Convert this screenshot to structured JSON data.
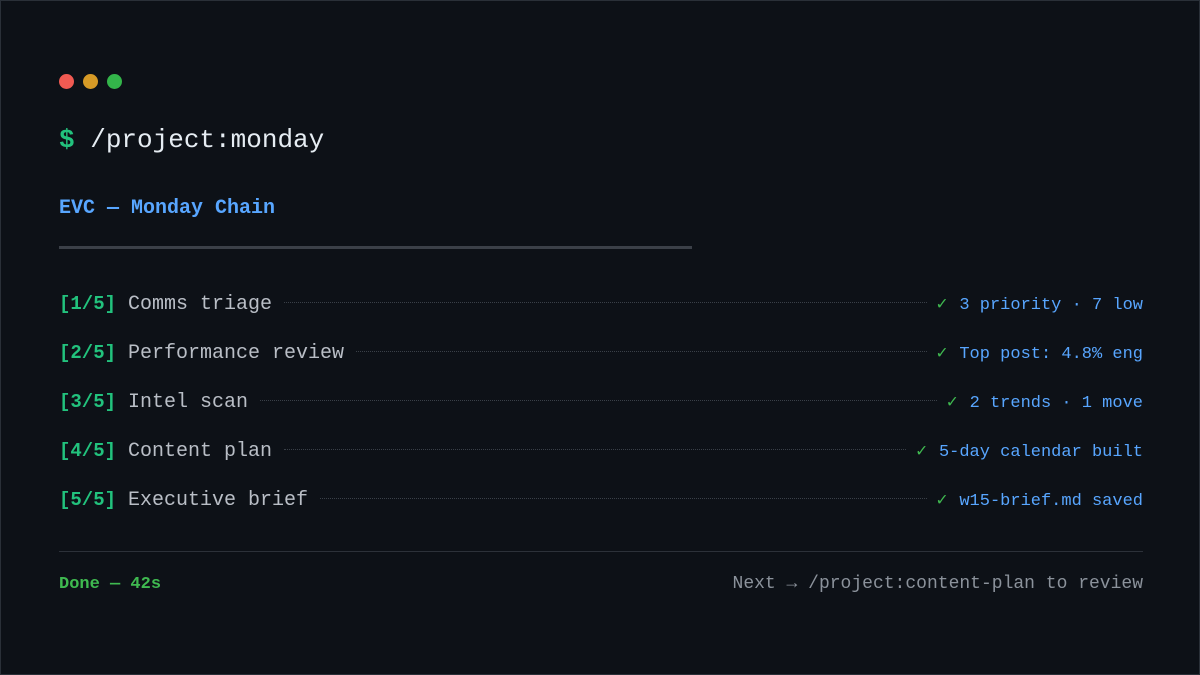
{
  "window": {
    "controls": [
      "close",
      "minimize",
      "maximize"
    ],
    "colors": {
      "close": "#f05a52",
      "minimize": "#d69a26",
      "maximize": "#33b54a"
    }
  },
  "prompt": {
    "symbol": "$",
    "command": "/project:monday"
  },
  "chain": {
    "title": "EVC — Monday Chain"
  },
  "steps": [
    {
      "num": "[1/5]",
      "name": "Comms triage",
      "check": "✓",
      "result": "3 priority · 7 low"
    },
    {
      "num": "[2/5]",
      "name": "Performance review",
      "check": "✓",
      "result": "Top post: 4.8% eng"
    },
    {
      "num": "[3/5]",
      "name": "Intel scan",
      "check": "✓",
      "result": "2 trends · 1 move"
    },
    {
      "num": "[4/5]",
      "name": "Content plan",
      "check": "✓",
      "result": "5-day calendar built"
    },
    {
      "num": "[5/5]",
      "name": "Executive brief",
      "check": "✓",
      "result": "w15-brief.md saved"
    }
  ],
  "footer": {
    "status": "Done — 42s",
    "next": "Next → /project:content-plan to review"
  },
  "theme": {
    "background": "#0d1117",
    "accent_green": "#22c27d",
    "accent_blue": "#58a6ff",
    "text": "#e6edf3",
    "muted": "#8b929b"
  }
}
